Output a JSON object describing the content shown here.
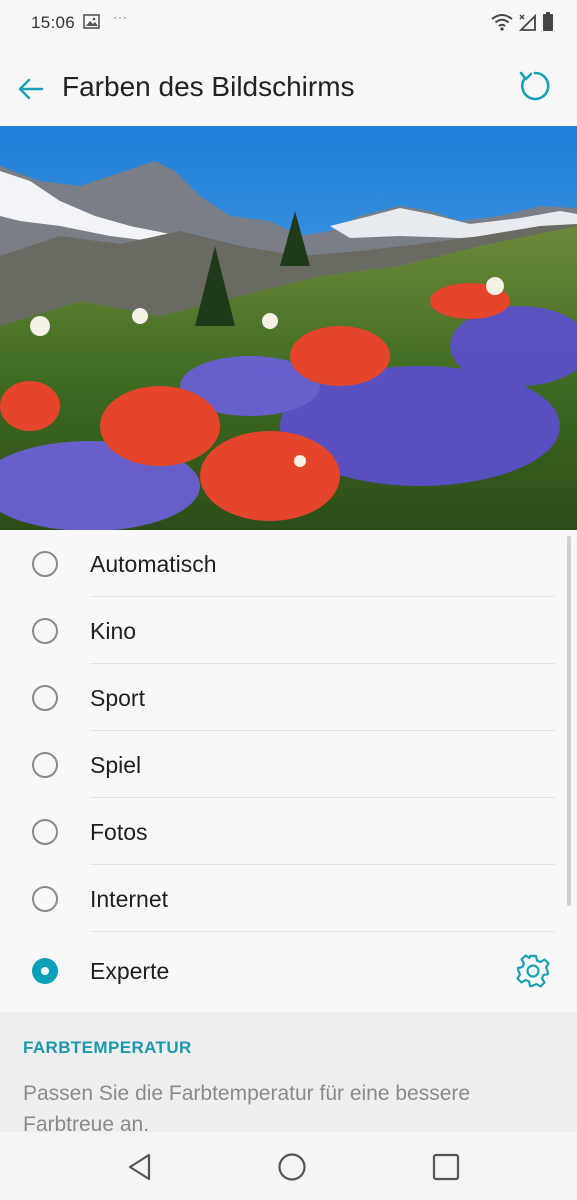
{
  "status_bar": {
    "time": "15:06",
    "dots": "···"
  },
  "app_bar": {
    "title": "Farben des Bildschirms"
  },
  "options": [
    {
      "label": "Automatisch",
      "checked": false
    },
    {
      "label": "Kino",
      "checked": false
    },
    {
      "label": "Sport",
      "checked": false
    },
    {
      "label": "Spiel",
      "checked": false
    },
    {
      "label": "Fotos",
      "checked": false
    },
    {
      "label": "Internet",
      "checked": false
    },
    {
      "label": "Experte",
      "checked": true
    }
  ],
  "color_temperature": {
    "title": "FARBTEMPERATUR",
    "description": "Passen Sie die Farbtemperatur für eine bessere Farbtreue an."
  },
  "icons": {
    "back": "back-arrow-icon",
    "reset": "refresh-icon",
    "settings": "gear-icon",
    "nav_back": "triangle-back-icon",
    "nav_home": "circle-home-icon",
    "nav_recents": "square-recents-icon"
  },
  "colors": {
    "accent": "#0aa0b8",
    "section_title": "#1b98ac"
  }
}
